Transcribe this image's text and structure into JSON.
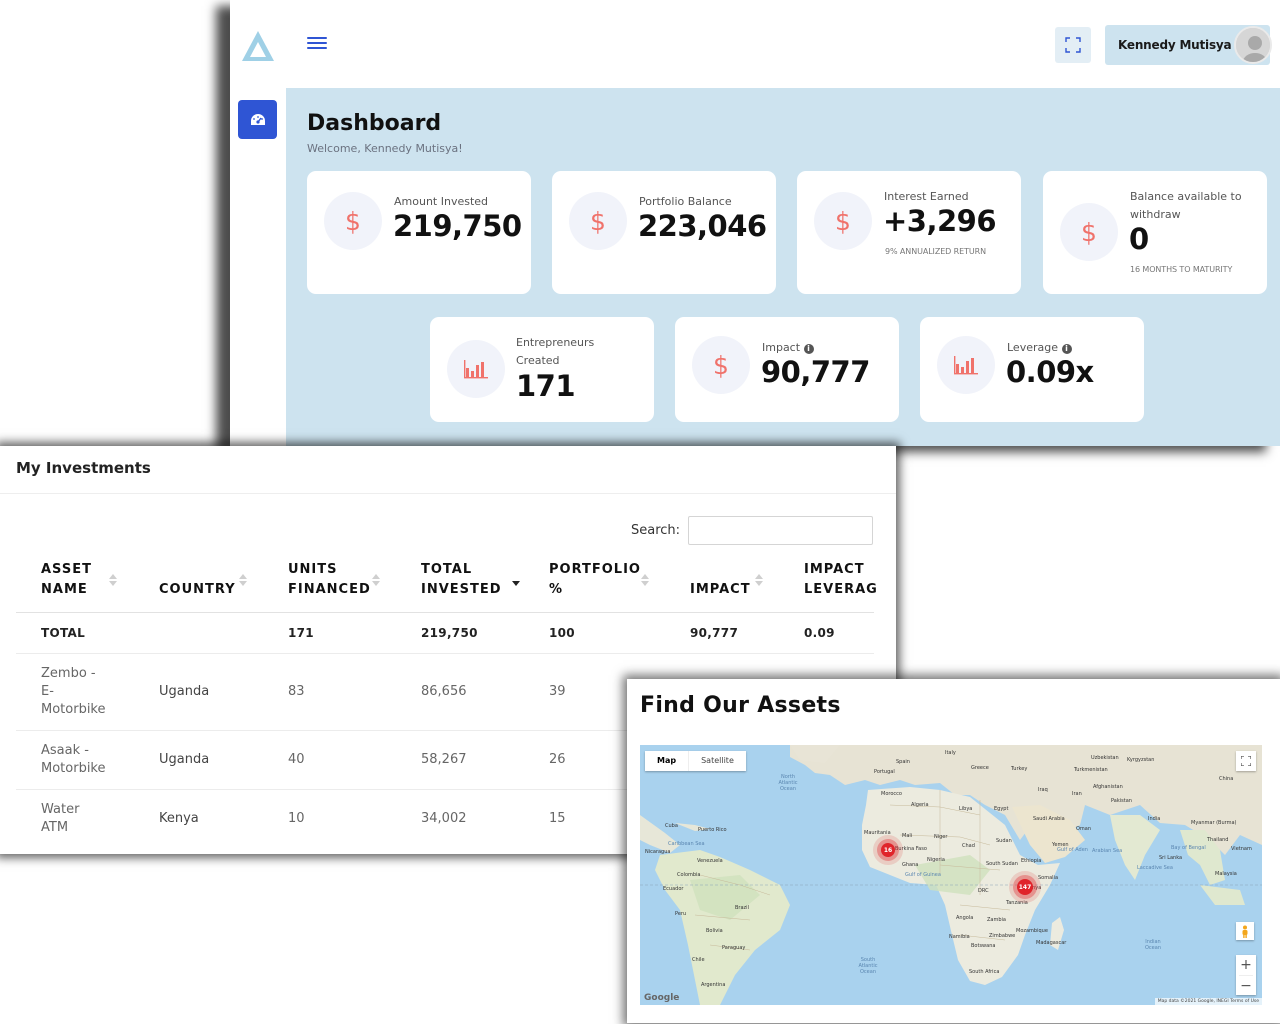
{
  "header": {
    "user_name": "Kennedy Mutisya"
  },
  "dashboard": {
    "title": "Dashboard",
    "welcome": "Welcome, Kennedy Mutisya!",
    "cards": [
      {
        "label": "Amount Invested",
        "value": "219,750",
        "icon": "dollar-icon"
      },
      {
        "label": "Portfolio Balance",
        "value": "223,046",
        "icon": "dollar-icon"
      },
      {
        "label": "Interest Earned",
        "value": "+3,296",
        "sub": "9% ANNUALIZED RETURN",
        "icon": "dollar-icon"
      },
      {
        "label": "Balance available to withdraw",
        "value": "0",
        "sub": "16 MONTHS TO MATURITY",
        "icon": "dollar-icon"
      },
      {
        "label": "Entrepreneurs Created",
        "value": "171",
        "icon": "bar-chart-icon"
      },
      {
        "label": "Impact",
        "value": "90,777",
        "icon": "dollar-icon",
        "info": "i"
      },
      {
        "label": "Leverage",
        "value": "0.09x",
        "icon": "bar-chart-icon",
        "info": "i"
      }
    ],
    "accent_color": "#2f55d4",
    "icon_color": "#f0726b"
  },
  "investments": {
    "title": "My Investments",
    "search_label": "Search:",
    "search_value": "",
    "columns": [
      {
        "line1": "ASSET",
        "line2": "NAME"
      },
      {
        "line1": "",
        "line2": "COUNTRY"
      },
      {
        "line1": "UNITS",
        "line2": "FINANCED"
      },
      {
        "line1": "TOTAL",
        "line2": "INVESTED"
      },
      {
        "line1": "PORTFOLIO",
        "line2": "%"
      },
      {
        "line1": "",
        "line2": "IMPACT"
      },
      {
        "line1": "IMPACT",
        "line2": "LEVERAG"
      }
    ],
    "total_row": [
      "TOTAL",
      "",
      "171",
      "219,750",
      "100",
      "90,777",
      "0.09"
    ],
    "rows": [
      {
        "asset": [
          "Zembo -",
          "E-",
          "Motorbike"
        ],
        "country": "Uganda",
        "units": "83",
        "invested": "86,656",
        "portfolio": "39"
      },
      {
        "asset": [
          "Asaak -",
          "Motorbike"
        ],
        "country": "Uganda",
        "units": "40",
        "invested": "58,267",
        "portfolio": "26"
      },
      {
        "asset": [
          "Water",
          "ATM"
        ],
        "country": "Kenya",
        "units": "10",
        "invested": "34,002",
        "portfolio": "15"
      }
    ]
  },
  "map": {
    "title": "Find Our Assets",
    "type_buttons": [
      "Map",
      "Satellite"
    ],
    "clusters": [
      {
        "count": "16"
      },
      {
        "count": "147"
      }
    ],
    "zoom_in": "+",
    "zoom_out": "−",
    "google": "Google",
    "attribution": "Map data ©2021 Google, INEGI   Terms of Use",
    "country_labels": [
      "Spain",
      "Portugal",
      "Italy",
      "Greece",
      "Turkey",
      "Uzbekistan",
      "Kyrgyzstan",
      "Turkmenistan",
      "Afghanistan",
      "China",
      "Morocco",
      "Algeria",
      "Libya",
      "Egypt",
      "Iraq",
      "Iran",
      "Pakistan",
      "Saudi Arabia",
      "Oman",
      "India",
      "Myanmar (Burma)",
      "Thailand",
      "Vietnam",
      "Mauritania",
      "Mali",
      "Niger",
      "Chad",
      "Sudan",
      "Yemen",
      "Burkina Faso",
      "Ghana",
      "Nigeria",
      "South Sudan",
      "Ethiopia",
      "Somalia",
      "Cuba",
      "Puerto Rico",
      "Nicaragua",
      "Venezuela",
      "Colombia",
      "Ecuador",
      "Peru",
      "Brazil",
      "Bolivia",
      "Paraguay",
      "Chile",
      "Argentina",
      "DRC",
      "Kenya",
      "Tanzania",
      "Angola",
      "Zambia",
      "Namibia",
      "Zimbabwe",
      "Botswana",
      "Mozambique",
      "Madagascar",
      "South Africa",
      "Malaysia",
      "Sri Lanka"
    ],
    "ocean_labels": [
      "North Atlantic Ocean",
      "South Atlantic Ocean",
      "Indian Ocean",
      "Caribbean Sea",
      "Gulf of Guinea",
      "Arabian Sea",
      "Bay of Bengal",
      "Gulf of Aden",
      "Laccadive Sea"
    ]
  }
}
